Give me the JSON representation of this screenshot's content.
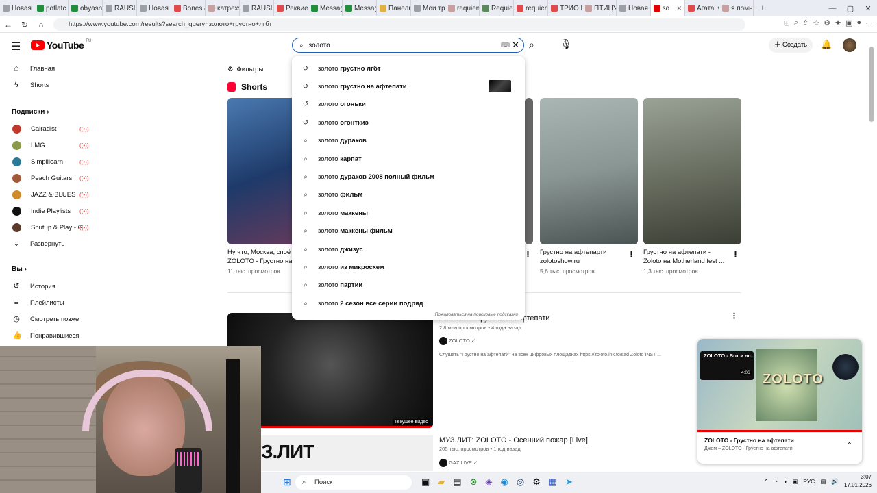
{
  "browser": {
    "tabs": [
      {
        "label": "Новая",
        "color": "#9aa0a6"
      },
      {
        "label": "potlatc",
        "color": "#1f8f3a"
      },
      {
        "label": "obyasni",
        "color": "#1f8f3a"
      },
      {
        "label": "RAUSH",
        "color": "#9aa0a6"
      },
      {
        "label": "Новая",
        "color": "#9aa0a6"
      },
      {
        "label": "Bones &",
        "color": "#e24a4a"
      },
      {
        "label": "катрехз",
        "color": "#c8a0a0"
      },
      {
        "label": "RAUSH",
        "color": "#9aa0a6"
      },
      {
        "label": "Реквие",
        "color": "#e24a4a"
      },
      {
        "label": "Messag",
        "color": "#1f8f3a"
      },
      {
        "label": "Messag",
        "color": "#1f8f3a"
      },
      {
        "label": "Панель",
        "color": "#e0b040"
      },
      {
        "label": "Мои тр",
        "color": "#9aa0a6"
      },
      {
        "label": "requien",
        "color": "#c8a0a0"
      },
      {
        "label": "Requie",
        "color": "#5a8a5a"
      },
      {
        "label": "requien",
        "color": "#e24a4a"
      },
      {
        "label": "ТРИО Н",
        "color": "#e24a4a"
      },
      {
        "label": "ПТИЦУ",
        "color": "#c8a0a0"
      },
      {
        "label": "Новая",
        "color": "#9aa0a6"
      },
      {
        "label": "зо",
        "color": "#e00000",
        "active": true
      },
      {
        "label": "Агата К",
        "color": "#e24a4a"
      },
      {
        "label": "я помн",
        "color": "#c8a0a0"
      }
    ],
    "url": "https://www.youtube.com/results?search_query=золото+грустно+лгбт"
  },
  "header": {
    "logo_text": "YouTube",
    "region": "RU",
    "search_value": "золото",
    "create_label": "Создать"
  },
  "sidebar": {
    "main": [
      {
        "label": "Главная",
        "icon": "home-icon"
      },
      {
        "label": "Shorts",
        "icon": "shorts-icon"
      }
    ],
    "subs_heading": "Подписки",
    "subs": [
      {
        "label": "Calradist",
        "color": "#c0392b"
      },
      {
        "label": "LMG",
        "color": "#8a9a4a"
      },
      {
        "label": "Simplilearn",
        "color": "#2a7a9a"
      },
      {
        "label": "Peach Guitars",
        "color": "#a05a3a"
      },
      {
        "label": "JAZZ & BLUES",
        "color": "#d08a2a"
      },
      {
        "label": "Indie Playlists",
        "color": "#111111"
      },
      {
        "label": "Shutup & Play - G...",
        "color": "#5a3a2a"
      }
    ],
    "expand": "Развернуть",
    "you_heading": "Вы",
    "you": [
      {
        "label": "История",
        "icon": "history-icon"
      },
      {
        "label": "Плейлисты",
        "icon": "playlist-icon"
      },
      {
        "label": "Смотреть позже",
        "icon": "clock-icon"
      },
      {
        "label": "Понравившиеся",
        "icon": "like-icon"
      }
    ]
  },
  "filters_label": "Фильтры",
  "shorts_heading": "Shorts",
  "shorts": [
    {
      "title1": "Ну что, Москва, споё",
      "title2": "ZOLOTO - Грустно на",
      "views": "11 тыс. просмотров"
    },
    {
      "title1": "Грустно на афтепарти",
      "title2": "zolotoshow.ru",
      "views": "5,6 тыс. просмотров"
    },
    {
      "title1": "Грустно на афтепати -",
      "title2": "Zoloto на Motherland fest ...",
      "views": "1,3 тыс. просмотров"
    }
  ],
  "suggestions": [
    {
      "prefix": "золото",
      "bold": "грустно лгбт",
      "icon": "history-icon"
    },
    {
      "prefix": "золото",
      "bold": "грустно на афтепати",
      "icon": "history-icon",
      "thumb": true
    },
    {
      "prefix": "золото",
      "bold": "огоньки",
      "icon": "history-icon"
    },
    {
      "prefix": "золото",
      "bold": "огонткиэ",
      "icon": "history-icon"
    },
    {
      "prefix": "золото",
      "bold": "дураков",
      "icon": "search-icon"
    },
    {
      "prefix": "золото",
      "bold": "карпат",
      "icon": "search-icon"
    },
    {
      "prefix": "золото",
      "bold": "дураков 2008 полный фильм",
      "icon": "search-icon"
    },
    {
      "prefix": "золото",
      "bold": "фильм",
      "icon": "search-icon"
    },
    {
      "prefix": "золото",
      "bold": "маккены",
      "icon": "search-icon"
    },
    {
      "prefix": "золото",
      "bold": "маккены фильм",
      "icon": "search-icon"
    },
    {
      "prefix": "золото",
      "bold": "джизус",
      "icon": "search-icon"
    },
    {
      "prefix": "золото",
      "bold": "из микросхем",
      "icon": "search-icon"
    },
    {
      "prefix": "золото",
      "bold": "партии",
      "icon": "search-icon"
    },
    {
      "prefix": "золото",
      "bold": "2 сезон все серии подряд",
      "icon": "search-icon"
    }
  ],
  "report_label": "Пожаловаться на поисковые подсказки",
  "video1": {
    "title": "ZOLOTO - Грустно на афтепати",
    "meta": "2,8 млн просмотров • 4 года назад",
    "channel": "ZOLOTO",
    "desc": "Слушать \"Грустно на афтепати\" на всех цифровых площадках https://zoloto.lnk.to/sad Zoloto INST ...",
    "now_playing": "Текущее видео"
  },
  "video2": {
    "title": "МУЗ.ЛИТ: ZOLOTO - Осенний пожар [Live]",
    "meta": "205 тыс. просмотров • 1 год назад",
    "channel": "GAZ LIVE",
    "thumb_text": "З.ЛИТ"
  },
  "miniplayer": {
    "overlay_title": "ZOLOTO - Вот и вс...",
    "duration": "4:06",
    "logo": "ZOLOTO",
    "title": "ZOLOTO - Грустно на афтепати",
    "subtitle": "Джем – ZOLOTO - Грустно на афтепати"
  },
  "taskbar": {
    "search": "Поиск",
    "lang": "РУС",
    "time": "3:07",
    "date": "17.01.2026"
  }
}
